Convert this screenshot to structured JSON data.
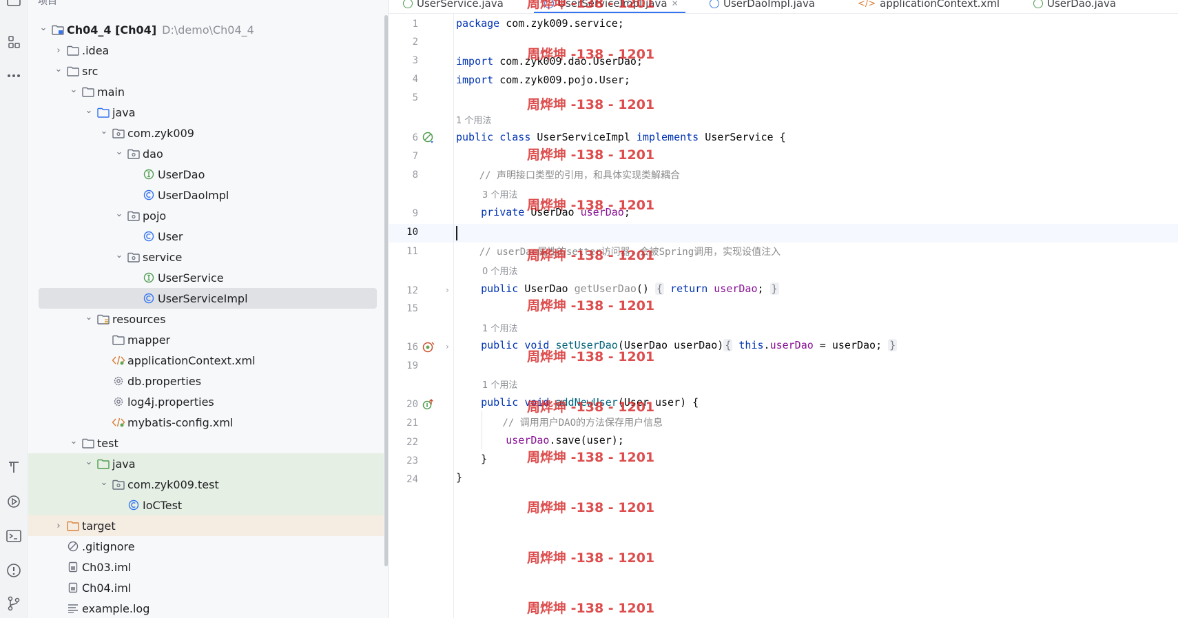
{
  "panel": {
    "title": "项目"
  },
  "activity_icons": [
    "project-icon",
    "structure-icon",
    "more-icon",
    "build-icon",
    "run-icon",
    "terminal-icon",
    "problems-icon",
    "git-icon"
  ],
  "tree": [
    {
      "label": "Ch04_4 [Ch04]",
      "path": "D:\\demo\\Ch04_4",
      "icon": "module-folder-icon",
      "depth": 0,
      "chevron": "open",
      "bold": true
    },
    {
      "label": ".idea",
      "icon": "folder-icon",
      "depth": 1,
      "chevron": "closed"
    },
    {
      "label": "src",
      "icon": "folder-icon",
      "depth": 1,
      "chevron": "open"
    },
    {
      "label": "main",
      "icon": "folder-icon",
      "depth": 2,
      "chevron": "open"
    },
    {
      "label": "java",
      "icon": "source-folder-icon",
      "depth": 3,
      "chevron": "open"
    },
    {
      "label": "com.zyk009",
      "icon": "package-icon",
      "depth": 4,
      "chevron": "open"
    },
    {
      "label": "dao",
      "icon": "package-icon",
      "depth": 5,
      "chevron": "open"
    },
    {
      "label": "UserDao",
      "icon": "interface-icon",
      "depth": 6,
      "chevron": "none"
    },
    {
      "label": "UserDaoImpl",
      "icon": "class-icon",
      "depth": 6,
      "chevron": "none"
    },
    {
      "label": "pojo",
      "icon": "package-icon",
      "depth": 5,
      "chevron": "open"
    },
    {
      "label": "User",
      "icon": "class-icon",
      "depth": 6,
      "chevron": "none"
    },
    {
      "label": "service",
      "icon": "package-icon",
      "depth": 5,
      "chevron": "open"
    },
    {
      "label": "UserService",
      "icon": "interface-icon",
      "depth": 6,
      "chevron": "none"
    },
    {
      "label": "UserServiceImpl",
      "icon": "class-icon",
      "depth": 6,
      "chevron": "none",
      "selected": true
    },
    {
      "label": "resources",
      "icon": "resources-folder-icon",
      "depth": 3,
      "chevron": "open"
    },
    {
      "label": "mapper",
      "icon": "folder-icon",
      "depth": 4,
      "chevron": "none"
    },
    {
      "label": "applicationContext.xml",
      "icon": "xml-icon",
      "depth": 4,
      "chevron": "none"
    },
    {
      "label": "db.properties",
      "icon": "properties-icon",
      "depth": 4,
      "chevron": "none"
    },
    {
      "label": "log4j.properties",
      "icon": "properties-icon",
      "depth": 4,
      "chevron": "none"
    },
    {
      "label": "mybatis-config.xml",
      "icon": "xml-icon",
      "depth": 4,
      "chevron": "none"
    },
    {
      "label": "test",
      "icon": "folder-icon",
      "depth": 2,
      "chevron": "open"
    },
    {
      "label": "java",
      "icon": "test-folder-icon",
      "depth": 3,
      "chevron": "open",
      "bg": "test"
    },
    {
      "label": "com.zyk009.test",
      "icon": "package-icon",
      "depth": 4,
      "chevron": "open",
      "bg": "test"
    },
    {
      "label": "IoCTest",
      "icon": "class-icon",
      "depth": 5,
      "chevron": "none",
      "bg": "test"
    },
    {
      "label": "target",
      "icon": "excluded-folder-icon",
      "depth": 1,
      "chevron": "closed",
      "bg": "excluded"
    },
    {
      "label": ".gitignore",
      "icon": "ignore-file-icon",
      "depth": 1,
      "chevron": "none"
    },
    {
      "label": "Ch03.iml",
      "icon": "iml-file-icon",
      "depth": 1,
      "chevron": "none"
    },
    {
      "label": "Ch04.iml",
      "icon": "iml-file-icon",
      "depth": 1,
      "chevron": "none"
    },
    {
      "label": "example.log",
      "icon": "text-file-icon",
      "depth": 1,
      "chevron": "none"
    }
  ],
  "tabs": [
    {
      "label": "UserService.java",
      "kind": "interface"
    },
    {
      "label": "UserServiceImpl.java",
      "kind": "class",
      "active": true
    },
    {
      "label": "UserDaoImpl.java",
      "kind": "class"
    },
    {
      "label": "applicationContext.xml",
      "kind": "xml"
    },
    {
      "label": "UserDao.java",
      "kind": "interface"
    }
  ],
  "editor": {
    "line_numbers": [
      "1",
      "2",
      "3",
      "4",
      "5",
      "6",
      "7",
      "8",
      "9",
      "10",
      "11",
      "12",
      "15",
      "16",
      "19",
      "20",
      "21",
      "22",
      "23",
      "24"
    ],
    "current_line": "10",
    "hints": {
      "h6": "1 个用法",
      "h9": "3 个用法",
      "h12": "0 个用法",
      "h16": "1 个用法",
      "h20": "1 个用法"
    },
    "code": {
      "l1_kw": "package",
      "l1_rest": " com.zyk009.service;",
      "l3_kw": "import",
      "l3_rest": " com.zyk009.dao.UserDao;",
      "l4_kw": "import",
      "l4_rest": " com.zyk009.pojo.User;",
      "l6_kw1": "public class",
      "l6_name": " UserServiceImpl ",
      "l6_kw2": "implements",
      "l6_rest": " UserService {",
      "l8_cmt": "    // 声明接口类型的引用，和具体实现类解耦合",
      "l9_kw": "    private",
      "l9_type": " UserDao ",
      "l9_fld": "userDao",
      "l9_end": ";",
      "l11_cmt": "    // userDao属性的setter访问器，会被Spring调用，实现设值注入",
      "l12_kw": "    public",
      "l12_type": " UserDao ",
      "l12_name": "getUserDao",
      "l12_paren": "()",
      "l12_open": "{",
      "l12_ret": " return ",
      "l12_fld": "userDao",
      "l12_semi": "; ",
      "l12_close": "}",
      "l16_kw": "    public void ",
      "l16_name": "setUserDao",
      "l16_params": "(UserDao userDao)",
      "l16_open": "{",
      "l16_this": " this",
      "l16_dot": ".",
      "l16_fld": "userDao",
      "l16_assign": " = userDao; ",
      "l16_close": "}",
      "l20_kw": "    public void ",
      "l20_name": "addNewUser",
      "l20_rest": "(User user) {",
      "l21_cmt": "        // 调用用户DAO的方法保存用户信息",
      "l22_fld": "        userDao",
      "l22_rest": ".save(user);",
      "l23": "    }",
      "l24": "}"
    }
  },
  "watermark": "周烨坤 -138 - 1201"
}
